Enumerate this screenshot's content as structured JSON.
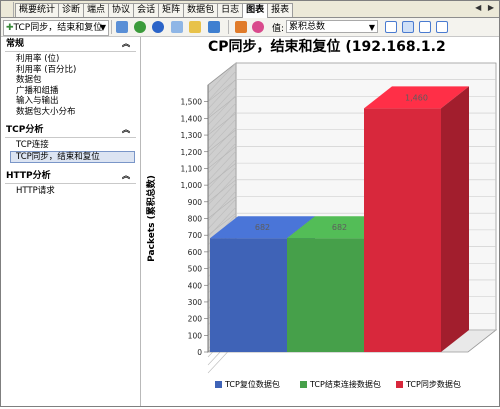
{
  "tabs": [
    {
      "label": "概要统计",
      "active": false
    },
    {
      "label": "诊断",
      "active": false
    },
    {
      "label": "端点",
      "active": false
    },
    {
      "label": "协议",
      "active": false
    },
    {
      "label": "会话",
      "active": false
    },
    {
      "label": "矩阵",
      "active": false
    },
    {
      "label": "数据包",
      "active": false
    },
    {
      "label": "日志",
      "active": false
    },
    {
      "label": "图表",
      "active": true
    },
    {
      "label": "报表",
      "active": false
    }
  ],
  "tab_nav": "◀ ▶",
  "toolbar": {
    "report_select": "TCP同步，结束和复位",
    "value_label": "值:",
    "value_select": "累积总数"
  },
  "sidebar": {
    "sections": [
      {
        "title": "常规",
        "items": [
          "利用率 (位)",
          "利用率 (百分比)",
          "数据包",
          "广播和组播",
          "输入与输出",
          "数据包大小分布"
        ]
      },
      {
        "title": "TCP分析",
        "items": [
          "TCP连接",
          "TCP同步，结束和复位"
        ]
      },
      {
        "title": "HTTP分析",
        "items": [
          "HTTP请求"
        ]
      }
    ],
    "selected_item": "TCP同步，结束和复位",
    "collapse_glyph": "︽"
  },
  "chart_data": {
    "type": "bar",
    "title": "CP同步，结束和复位 (192.168.1.2",
    "ylabel": "Packets (累积总数)",
    "ylim": [
      0,
      1600
    ],
    "yticks": [
      0,
      100,
      200,
      300,
      400,
      500,
      600,
      700,
      800,
      900,
      1000,
      1100,
      1200,
      1300,
      1400,
      1500
    ],
    "grid": true,
    "legend_position": "bottom",
    "series": [
      {
        "name": "TCP复位数据包",
        "value": 682,
        "label": "682",
        "color": "#3f63b7"
      },
      {
        "name": "TCP结束连接数据包",
        "value": 682,
        "label": "682",
        "color": "#46a04a"
      },
      {
        "name": "TCP同步数据包",
        "value": 1460,
        "label": "1,460",
        "color": "#d8283c"
      }
    ]
  }
}
